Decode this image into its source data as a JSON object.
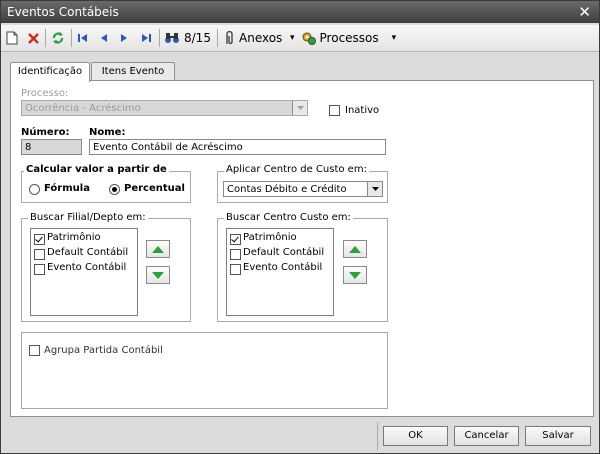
{
  "window": {
    "title": "Eventos Contábeis"
  },
  "toolbar": {
    "record_position": "8/15",
    "attachments_label": "Anexos",
    "processes_label": "Processos"
  },
  "tabs": [
    {
      "label": "Identificação",
      "active": true
    },
    {
      "label": "Itens Evento",
      "active": false
    }
  ],
  "form": {
    "processo_label": "Processo:",
    "processo_value": "Ocorrência - Acréscimo",
    "inativo_label": "Inativo",
    "inativo_checked": false,
    "numero_label": "Número:",
    "numero_value": "8",
    "nome_label": "Nome:",
    "nome_value": "Evento Contábil de Acréscimo",
    "calcular": {
      "legend": "Calcular valor a partir de",
      "options": [
        {
          "label": "Fórmula",
          "selected": false
        },
        {
          "label": "Percentual",
          "selected": true
        }
      ]
    },
    "centro_custo": {
      "legend": "Aplicar Centro de Custo em:",
      "selected": "Contas Débito e Crédito"
    },
    "filial": {
      "legend": "Buscar Filial/Depto em:",
      "items": [
        {
          "label": "Patrimônio",
          "checked": true
        },
        {
          "label": "Default Contábil",
          "checked": false
        },
        {
          "label": "Evento Contábil",
          "checked": false
        }
      ]
    },
    "centro": {
      "legend": "Buscar Centro Custo em:",
      "items": [
        {
          "label": "Patrimônio",
          "checked": true
        },
        {
          "label": "Default Contábil",
          "checked": false
        },
        {
          "label": "Evento Contábil",
          "checked": false
        }
      ]
    },
    "agrupa_label": "Agrupa Partida Contábil",
    "agrupa_checked": false
  },
  "buttons": {
    "ok": "OK",
    "cancel": "Cancelar",
    "save": "Salvar"
  },
  "colors": {
    "titlebar": "#4a4a4a",
    "up_arrow": "#2e9e3e",
    "nav_arrow": "#2a5ab8",
    "delete": "#d02a1a"
  }
}
